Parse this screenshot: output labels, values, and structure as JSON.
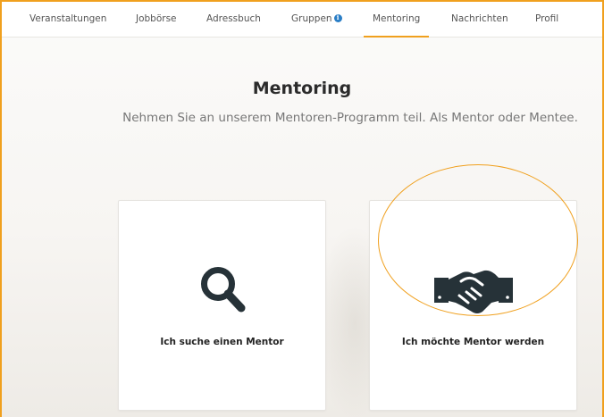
{
  "nav": {
    "items": [
      {
        "label": "Veranstaltungen"
      },
      {
        "label": "Jobbörse"
      },
      {
        "label": "Adressbuch"
      },
      {
        "label": "Gruppen"
      },
      {
        "label": "Mentoring",
        "active": true
      },
      {
        "label": "Nachrichten"
      },
      {
        "label": "Profil"
      }
    ]
  },
  "main": {
    "title": "Mentoring",
    "subtitle": "Nehmen Sie an unserem Mentoren-Programm teil. Als Mentor oder Mentee."
  },
  "cards": [
    {
      "label": "Ich suche einen Mentor",
      "icon": "search-icon"
    },
    {
      "label": "Ich möchte Mentor werden",
      "icon": "handshake-icon"
    }
  ],
  "colors": {
    "accent": "#f0a01e",
    "info": "#2a7ec6",
    "icon": "#263238"
  }
}
